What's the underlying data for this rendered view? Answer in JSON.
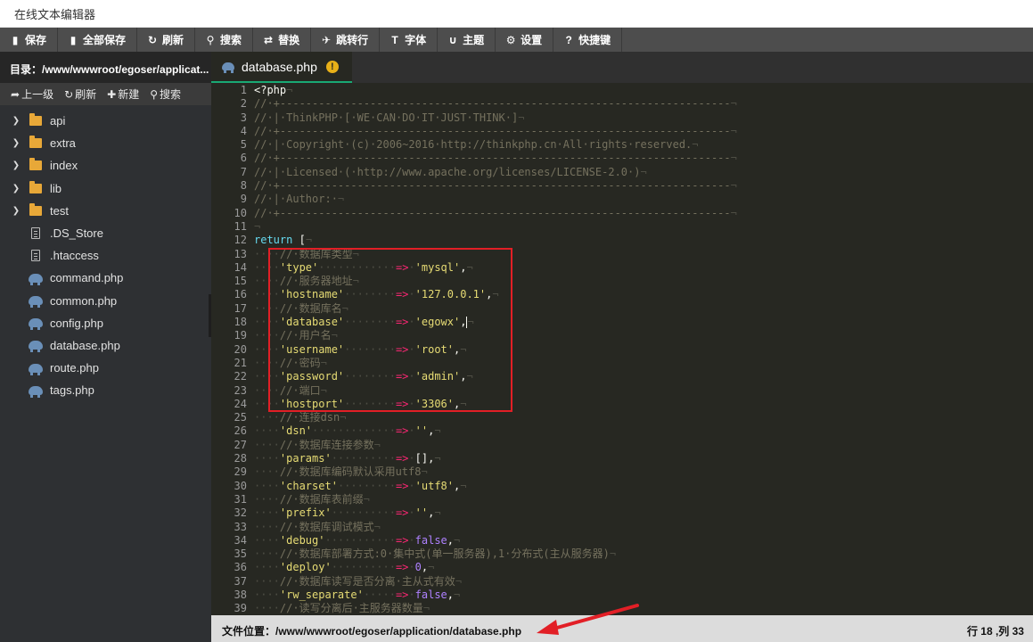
{
  "window": {
    "title": "在线文本编辑器"
  },
  "toolbar": {
    "buttons": [
      {
        "label": "保存",
        "icon": "save-icon",
        "glyph": "▮"
      },
      {
        "label": "全部保存",
        "icon": "save-all-icon",
        "glyph": "▮"
      },
      {
        "label": "刷新",
        "icon": "refresh-icon",
        "glyph": "↻"
      },
      {
        "label": "搜索",
        "icon": "search-icon",
        "glyph": "⚲"
      },
      {
        "label": "替换",
        "icon": "replace-icon",
        "glyph": "⇄"
      },
      {
        "label": "跳转行",
        "icon": "jump-icon",
        "glyph": "✈"
      },
      {
        "label": "字体",
        "icon": "font-icon",
        "glyph": "T"
      },
      {
        "label": "主题",
        "icon": "theme-icon",
        "glyph": "∪"
      },
      {
        "label": "设置",
        "icon": "gear-icon",
        "glyph": "⚙"
      },
      {
        "label": "快捷键",
        "icon": "help-icon",
        "glyph": "?"
      }
    ]
  },
  "sidebar": {
    "directory": "目录：/www/wwwroot/egoser/applicat...",
    "tools": [
      {
        "label": "上一级",
        "icon": "arrow-up-icon",
        "glyph": "➦"
      },
      {
        "label": "刷新",
        "icon": "refresh-icon",
        "glyph": "↻"
      },
      {
        "label": "新建",
        "icon": "plus-icon",
        "glyph": "✚"
      },
      {
        "label": "搜索",
        "icon": "search-icon",
        "glyph": "⚲"
      }
    ],
    "items": [
      {
        "name": "api",
        "type": "folder"
      },
      {
        "name": "extra",
        "type": "folder"
      },
      {
        "name": "index",
        "type": "folder"
      },
      {
        "name": "lib",
        "type": "folder"
      },
      {
        "name": "test",
        "type": "folder"
      },
      {
        "name": ".DS_Store",
        "type": "file"
      },
      {
        "name": ".htaccess",
        "type": "file"
      },
      {
        "name": "command.php",
        "type": "php"
      },
      {
        "name": "common.php",
        "type": "php"
      },
      {
        "name": "config.php",
        "type": "php"
      },
      {
        "name": "database.php",
        "type": "php"
      },
      {
        "name": "route.php",
        "type": "php"
      },
      {
        "name": "tags.php",
        "type": "php"
      }
    ]
  },
  "tab": {
    "name": "database.php",
    "warning": "!"
  },
  "editor": {
    "lines": [
      "<?php",
      "// +----------------------------------------------------------------------",
      "// | ThinkPHP [ WE CAN DO IT JUST THINK ]",
      "// +----------------------------------------------------------------------",
      "// | Copyright (c) 2006~2016 http://thinkphp.cn All rights reserved.",
      "// +----------------------------------------------------------------------",
      "// | Licensed ( http://www.apache.org/licenses/LICENSE-2.0 )",
      "// +----------------------------------------------------------------------",
      "// | Author: ",
      "// +----------------------------------------------------------------------",
      "",
      "return [",
      "    // 数据库类型",
      "    'type'            => 'mysql',",
      "    // 服务器地址",
      "    'hostname'        => '127.0.0.1',",
      "    // 数据库名",
      "    'database'        => 'egowx',",
      "    // 用户名",
      "    'username'        => 'root',",
      "    // 密码",
      "    'password'        => 'admin',",
      "    // 端口",
      "    'hostport'        => '3306',",
      "    // 连接dsn",
      "    'dsn'             => '',",
      "    // 数据库连接参数",
      "    'params'          => [],",
      "    // 数据库编码默认采用utf8",
      "    'charset'         => 'utf8',",
      "    // 数据库表前缀",
      "    'prefix'          => '',",
      "    // 数据库调试模式",
      "    'debug'           => false,",
      "    // 数据库部署方式:0 集中式(单一服务器),1 分布式(主从服务器)",
      "    'deploy'          => 0,",
      "    // 数据库读写是否分离 主从式有效",
      "    'rw_separate'     => false,",
      "    // 读写分离后 主服务器数量"
    ],
    "cursor_line": 18
  },
  "status": {
    "path": "文件位置：/www/wwwroot/egoser/application/database.php",
    "position": "行 18 ,列 33"
  },
  "colors": {
    "toolbar_bg": "#4d4d4d",
    "sidebar_bg": "#2e3033",
    "editor_bg": "#272822",
    "accent_tab": "#19a974",
    "annotation_red": "#e21f26"
  }
}
